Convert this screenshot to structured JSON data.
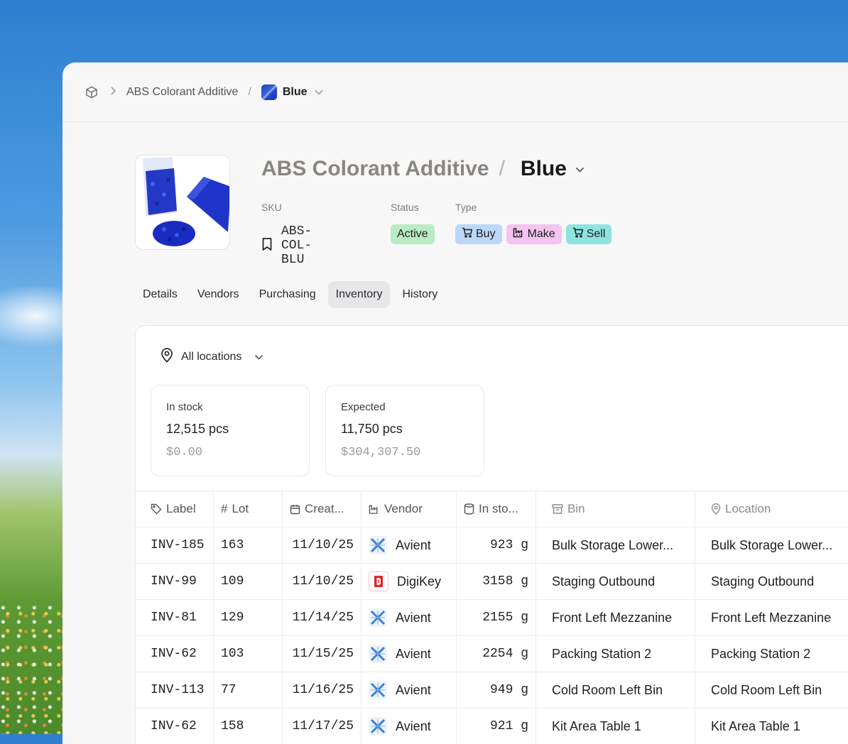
{
  "breadcrumb": {
    "parent": "ABS Colorant Additive",
    "separator": "/",
    "current": "Blue"
  },
  "product": {
    "parent_name": "ABS Colorant Additive",
    "title_separator": "/",
    "variant_name": "Blue",
    "sku_label": "SKU",
    "sku": "ABS-COL-BLU",
    "status_label": "Status",
    "status": "Active",
    "type_label": "Type",
    "types": [
      {
        "label": "Buy",
        "icon": "cart-icon",
        "color": "#bcd7f8"
      },
      {
        "label": "Make",
        "icon": "factory-icon",
        "color": "#f3c4ef"
      },
      {
        "label": "Sell",
        "icon": "cart-icon",
        "color": "#8fe3df"
      }
    ],
    "status_color": "#b9ecc3"
  },
  "tabs": [
    "Details",
    "Vendors",
    "Purchasing",
    "Inventory",
    "History"
  ],
  "active_tab": "Inventory",
  "location_filter": "All locations",
  "stats": [
    {
      "label": "In stock",
      "qty": "12,515 pcs",
      "value": "$0.00"
    },
    {
      "label": "Expected",
      "qty": "11,750 pcs",
      "value": "$304,307.50"
    }
  ],
  "table": {
    "headers": [
      "Label",
      "Lot",
      "Creat...",
      "Vendor",
      "In sto...",
      "Bin",
      "Location"
    ],
    "rows": [
      {
        "label": "INV-185",
        "lot": "163",
        "created": "11/10/25",
        "vendor": "Avient",
        "in_stock": "923 g",
        "bin": "Bulk Storage Lower...",
        "location": "Bulk Storage Lower..."
      },
      {
        "label": "INV-99",
        "lot": "109",
        "created": "11/10/25",
        "vendor": "DigiKey",
        "in_stock": "3158 g",
        "bin": "Staging Outbound",
        "location": "Staging Outbound"
      },
      {
        "label": "INV-81",
        "lot": "129",
        "created": "11/14/25",
        "vendor": "Avient",
        "in_stock": "2155 g",
        "bin": "Front Left Mezzanine",
        "location": "Front Left Mezzanine"
      },
      {
        "label": "INV-62",
        "lot": "103",
        "created": "11/15/25",
        "vendor": "Avient",
        "in_stock": "2254 g",
        "bin": "Packing Station 2",
        "location": "Packing Station 2"
      },
      {
        "label": "INV-113",
        "lot": "77",
        "created": "11/16/25",
        "vendor": "Avient",
        "in_stock": "949 g",
        "bin": "Cold Room Left Bin",
        "location": "Cold Room Left Bin"
      },
      {
        "label": "INV-62",
        "lot": "158",
        "created": "11/17/25",
        "vendor": "Avient",
        "in_stock": "921 g",
        "bin": "Kit Area Table 1",
        "location": "Kit Area Table 1"
      }
    ]
  }
}
